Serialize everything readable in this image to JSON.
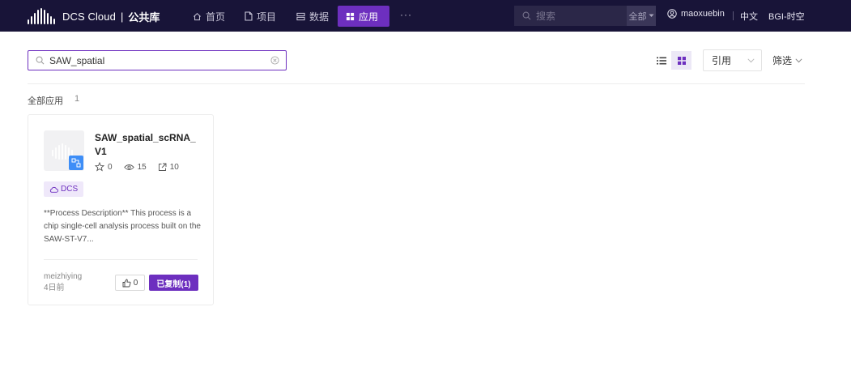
{
  "header": {
    "app_name": "DCS Cloud",
    "separator": "|",
    "section": "公共库",
    "nav": [
      {
        "label": "首页",
        "icon": "home-icon"
      },
      {
        "label": "项目",
        "icon": "file-icon"
      },
      {
        "label": "数据",
        "icon": "database-icon"
      },
      {
        "label": "应用",
        "icon": "grid-icon",
        "active": true
      }
    ],
    "more": "···",
    "search_placeholder": "搜索",
    "search_scope": "全部",
    "username": "maoxuebin",
    "language": "中文",
    "organization": "BGI-时空"
  },
  "toolbar": {
    "search_value": "SAW_spatial",
    "sort_label": "引用",
    "filter_label": "筛选"
  },
  "section": {
    "title": "全部应用",
    "count": "1"
  },
  "cards": [
    {
      "title": "SAW_spatial_scRNA_V1",
      "stars": "0",
      "views": "15",
      "references": "10",
      "tag": "DCS",
      "description": "**Process Description** This process is a chip single-cell analysis process built on the SAW-ST-V7...",
      "author": "meizhiying",
      "time": "4日前",
      "likes": "0",
      "copy_label": "已复制(1)"
    }
  ],
  "colors": {
    "topbar": "#181438",
    "accent": "#6d2fbf",
    "badge": "#3e8ef7"
  }
}
